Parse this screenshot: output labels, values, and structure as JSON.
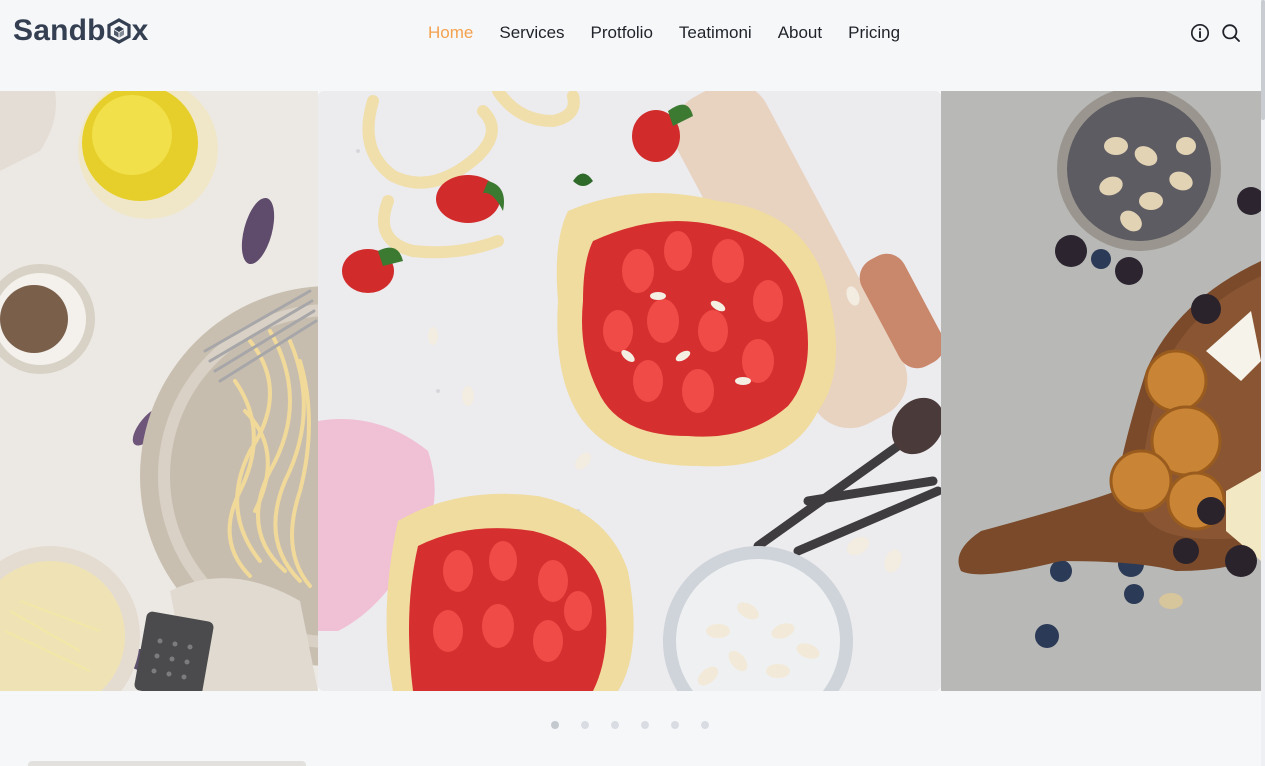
{
  "brand": {
    "name_prefix": "Sandb",
    "name_suffix": "x",
    "logo_color": "#343f52"
  },
  "nav": {
    "items": [
      {
        "label": "Home",
        "active": true
      },
      {
        "label": "Services",
        "active": false
      },
      {
        "label": "Protfolio",
        "active": false
      },
      {
        "label": "Teatimoni",
        "active": false
      },
      {
        "label": "About",
        "active": false
      },
      {
        "label": "Pricing",
        "active": false
      }
    ],
    "active_color": "#f4a24f"
  },
  "header_icons": [
    "info-icon",
    "search-icon"
  ],
  "slider": {
    "slides": [
      {
        "subject": "pasta-dish",
        "position": "left"
      },
      {
        "subject": "strawberry-galettes",
        "position": "center"
      },
      {
        "subject": "cheese-board",
        "position": "right"
      }
    ],
    "dots": [
      {
        "active": true
      },
      {
        "active": false
      },
      {
        "active": false
      },
      {
        "active": false
      },
      {
        "active": false
      },
      {
        "active": false
      }
    ]
  }
}
